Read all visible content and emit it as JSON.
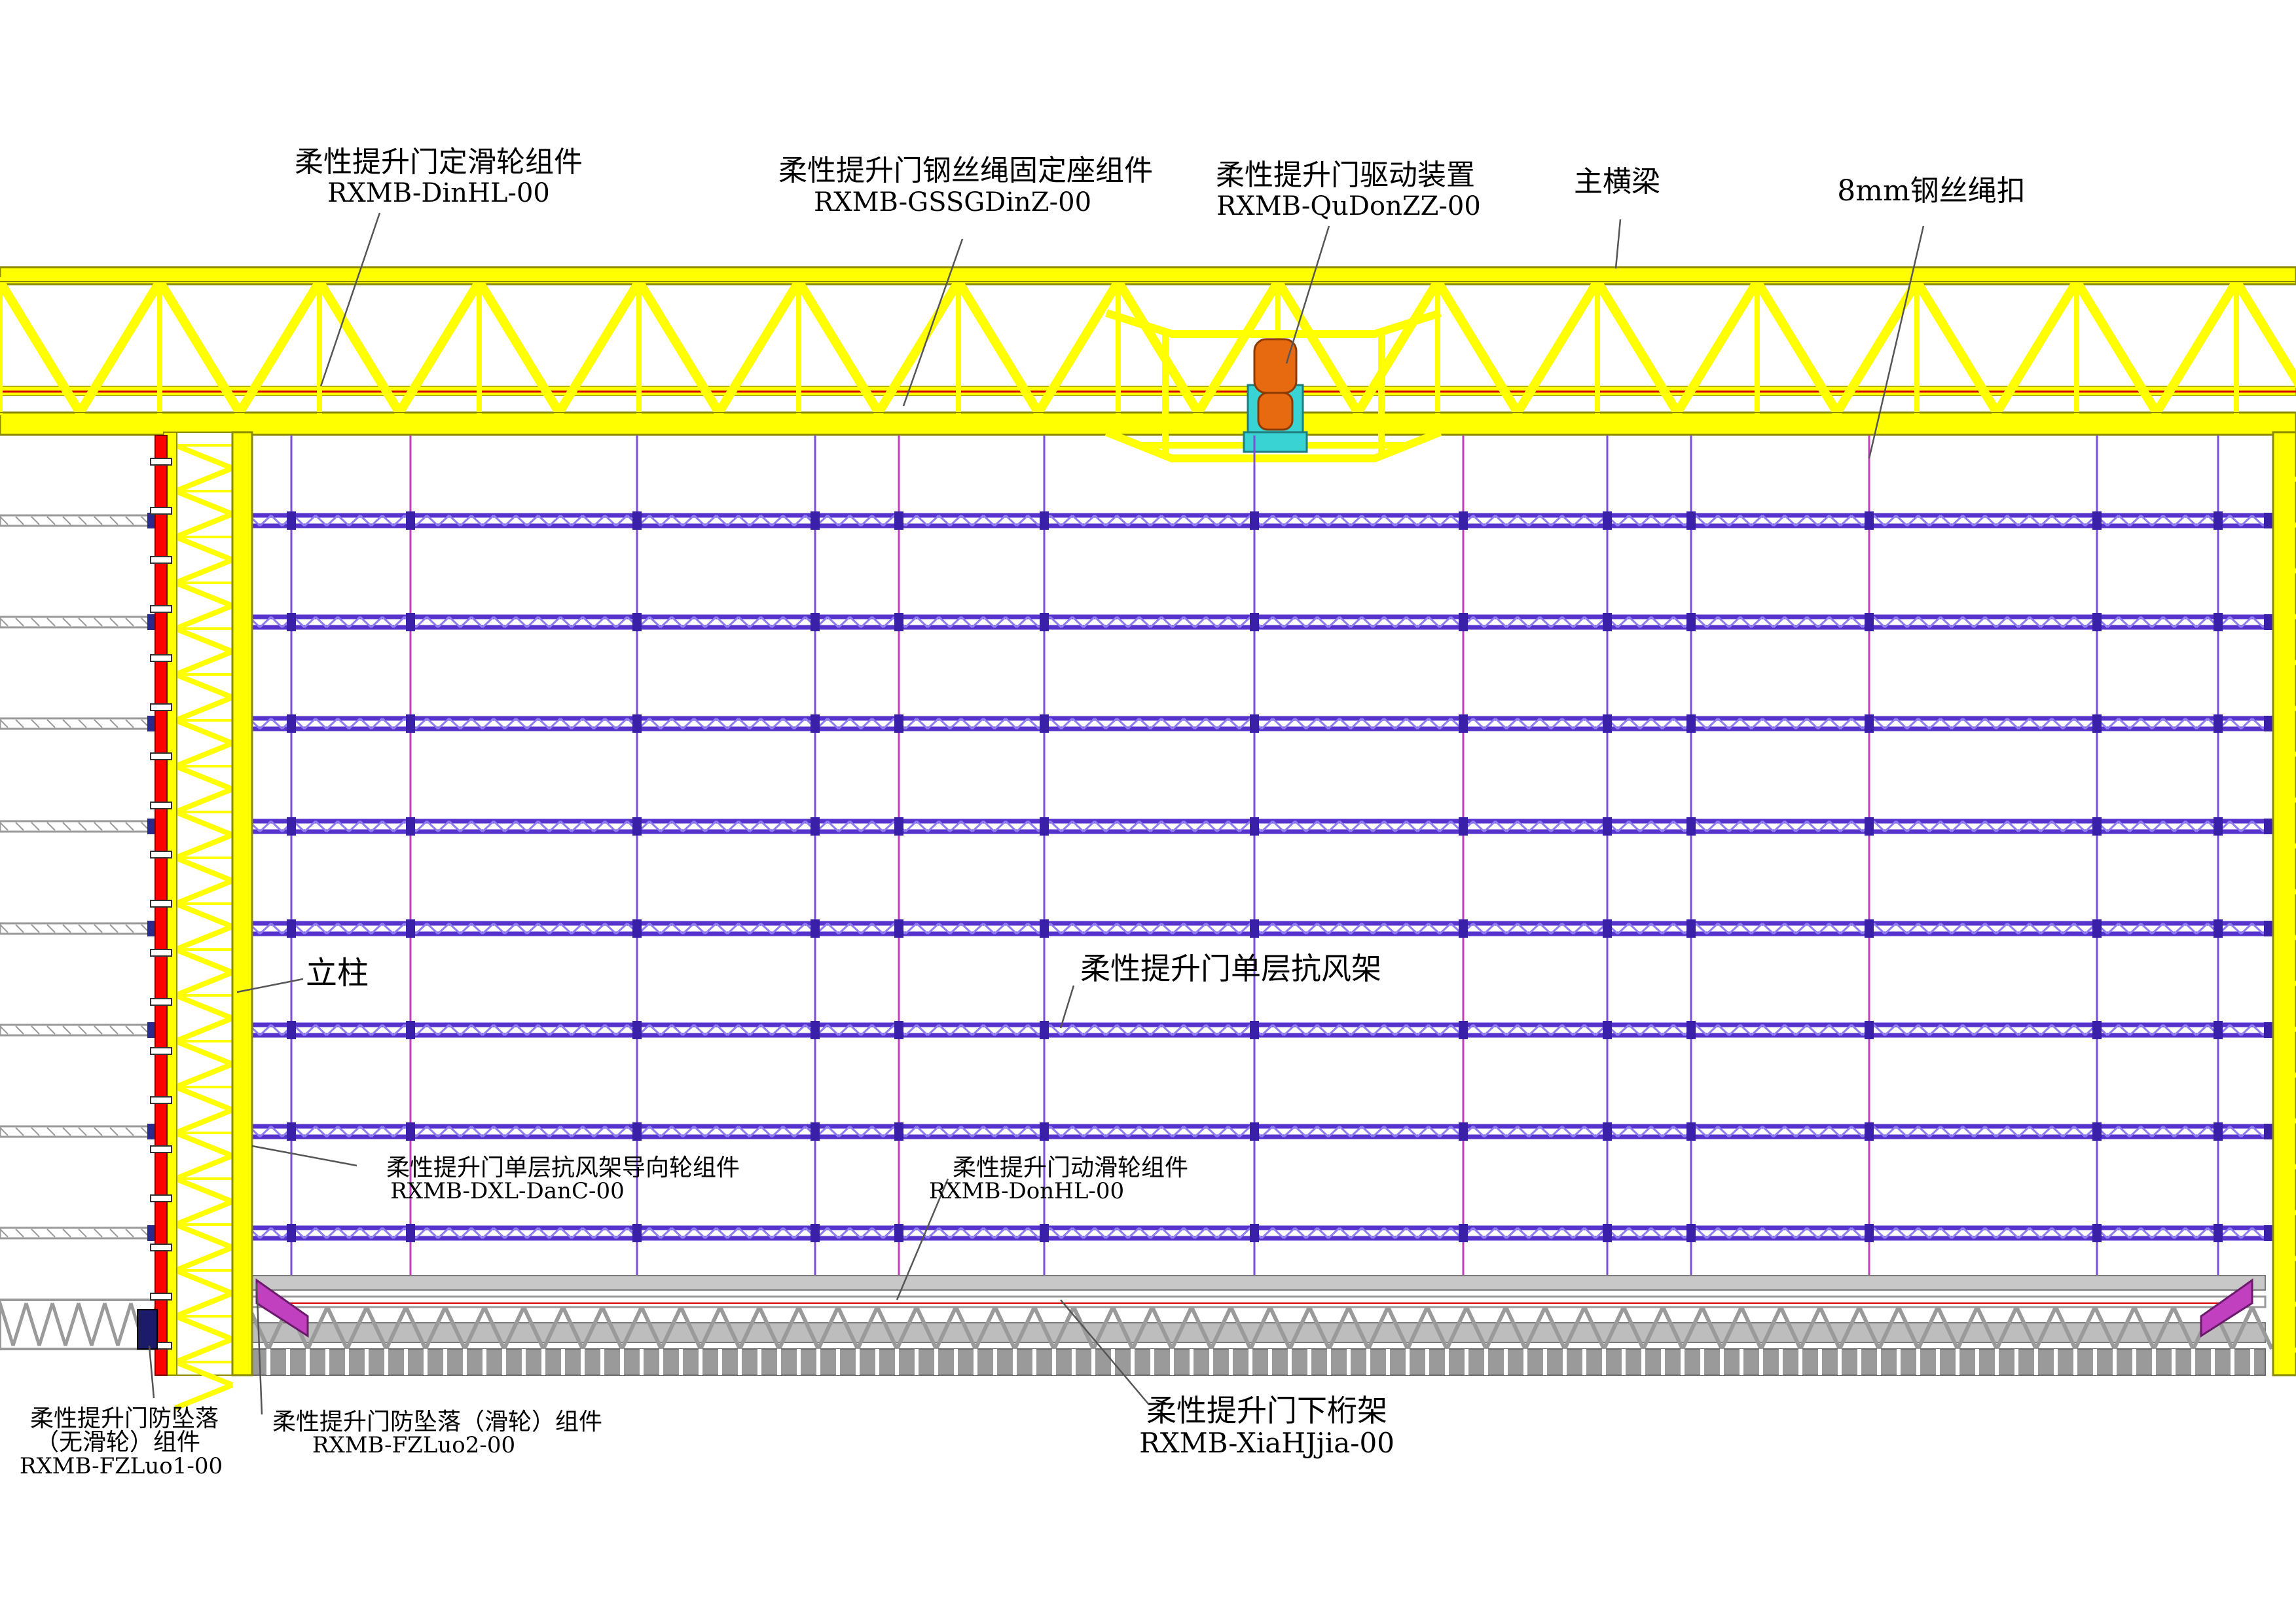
{
  "colors": {
    "frame_yellow": "#ffff00",
    "frame_outline": "#8a8a00",
    "frame_shadow": "#b3b300",
    "windframe_purple": "#5533cc",
    "windframe_light": "#8f7cf0",
    "rail_red": "#ff0000",
    "rail_dark": "#7a0000",
    "rope_red": "#d40000",
    "hanger_purple": "#7b4fd6",
    "hanger_magenta": "#c040c0",
    "drive_orange": "#e86a10",
    "drive_cyan": "#39d3d3",
    "truss_white": "#ffffff",
    "truss_gray": "#9a9a9a",
    "leader_gray": "#555555",
    "label_black": "#000000"
  },
  "labels": {
    "fixed_pulley": {
      "name": "柔性提升门定滑轮组件",
      "code": "RXMB-DinHL-00"
    },
    "rope_anchor": {
      "name": "柔性提升门钢丝绳固定座组件",
      "code": "RXMB-GSSGDinZ-00"
    },
    "drive_unit": {
      "name": "柔性提升门驱动装置",
      "code": "RXMB-QuDonZZ-00"
    },
    "main_beam": {
      "name": "主横梁"
    },
    "rope_clip": {
      "name": "8mm钢丝绳扣"
    },
    "column": {
      "name": "立柱"
    },
    "wind_frame": {
      "name": "柔性提升门单层抗风架"
    },
    "guide_wheel": {
      "name": "柔性提升门单层抗风架导向轮组件",
      "code": "RXMB-DXL-DanC-00"
    },
    "moving_pulley": {
      "name": "柔性提升门动滑轮组件",
      "code": "RXMB-DonHL-00"
    },
    "anti_fall_no_pulley": {
      "line1": "柔性提升门防坠落",
      "line2": "（无滑轮）组件",
      "code": "RXMB-FZLuo1-00"
    },
    "anti_fall_pulley": {
      "name": "柔性提升门防坠落（滑轮）组件",
      "code": "RXMB-FZLuo2-00"
    },
    "bottom_truss": {
      "name": "柔性提升门下桁架",
      "code": "RXMB-XiaHJjia-00"
    }
  }
}
